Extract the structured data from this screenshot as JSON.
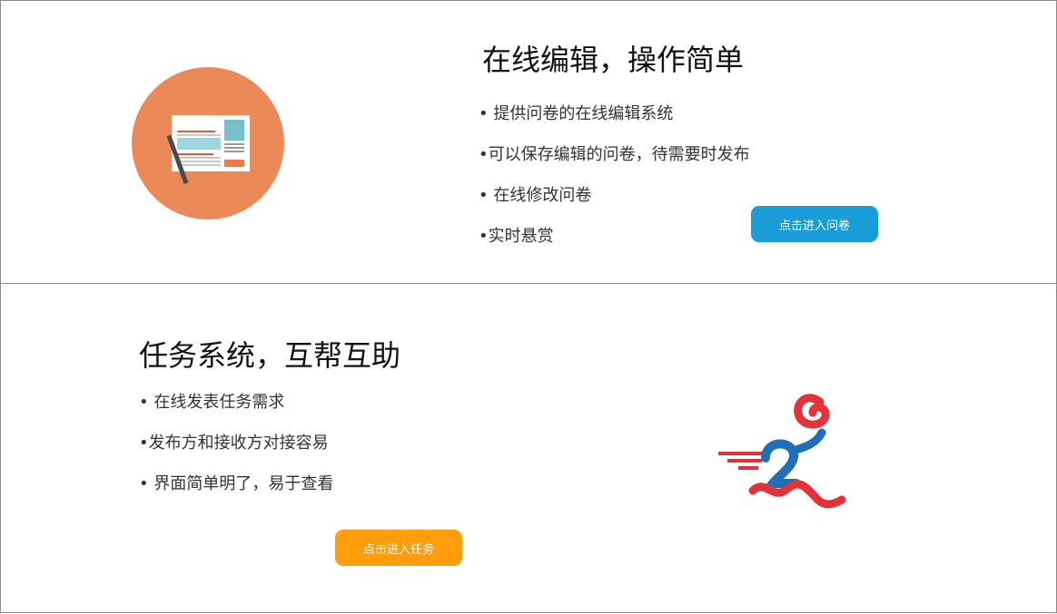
{
  "colors": {
    "edit_circle": "#ec8958",
    "button_blue": "#1a9cd8",
    "button_orange": "#ff9d0a",
    "runner_red": "#e53238",
    "runner_blue": "#1f6fb8"
  },
  "section_editor": {
    "title": "在线编辑，操作简单",
    "bullets": [
      "• 提供问卷的在线编辑系统",
      "•可以保存编辑的问卷，待需要时发布",
      "• 在线修改问卷",
      "•实时悬赏"
    ],
    "button_label": "点击进入问卷",
    "illustration_icon": "newspaper-edit-icon"
  },
  "section_tasks": {
    "title": "任务系统，互帮互助",
    "bullets": [
      "• 在线发表任务需求",
      "•发布方和接收方对接容易",
      "• 界面简单明了，易于查看"
    ],
    "button_label": "点击进入任务",
    "illustration_icon": "running-person-icon"
  }
}
